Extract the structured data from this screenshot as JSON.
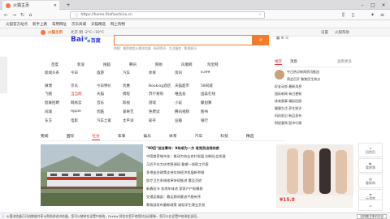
{
  "tab": {
    "title": "火狐主页"
  },
  "url": "https://home.firefoxchina.cn",
  "bookmarks": [
    "火狐官方站点",
    "新手上路",
    "常用网址",
    "京东商城",
    "天猫精选",
    "网上购物"
  ],
  "page_header": {
    "brand": "火狐主页",
    "weather": "北京 阴 -2°C~10°C",
    "right_links": [
      "设置",
      "火狐帮助"
    ]
  },
  "search": {
    "logo_prefix": "Bai",
    "logo_du": "百度",
    "button": "搜索"
  },
  "hot_words": "热搜：推荐使用火狐浏览器 · 新闻资讯 · 生活服务 · 影视娱乐",
  "grid": [
    [
      "百度",
      "新浪",
      "搜狐",
      "腾讯",
      "网易",
      "凤凰网",
      "淘宝网"
    ],
    [
      "新闻头条",
      "今日",
      "旅游",
      "汽车",
      "体育",
      "资讯",
      "4399"
    ],
    [
      "微博",
      "京东",
      "今日特价",
      "优惠",
      "Booking酒店",
      "天猫超市",
      "58同城"
    ],
    [
      "飞猪",
      "当当网",
      "天猫",
      "携程",
      "苏宁易购",
      "唯品会",
      "国美在线"
    ],
    [
      "智联招聘",
      "网易云",
      "音乐",
      "影视",
      "游戏",
      "小说",
      "聚划算"
    ],
    [
      "同城",
      "Apple",
      "优酷",
      "爱奇艺",
      "免费试",
      "腾讯视频",
      "图书"
    ],
    [
      "东方",
      "电影",
      "汽车之家",
      "太平洋",
      "知乎",
      "豆瓣",
      "银行"
    ]
  ],
  "right_panel": {
    "tabs": [
      "推荐",
      "消息",
      "查看更多"
    ],
    "lines": [
      "今日热点新闻资讯推送",
      "两会召开 聚焦民生热点",
      "好友动态 最新消息",
      "国际新闻 每日更新",
      "体育赛事 精彩回顾",
      "健康生活 养生知识",
      "科技前沿 新品发布",
      "财经要闻 股市行情"
    ]
  },
  "categories": [
    "要闻",
    "国际",
    "社会",
    "军事",
    "娱乐",
    "体育",
    "汽车",
    "科技",
    "精选"
  ],
  "active_category": "社会",
  "news": {
    "headline": "\"90后\"创业青年：9年成为一方 老党员出钱扶贫",
    "lines": [
      "中国首家城市化：推动为农业农村发展 创新社会发展",
      "习近平在大庆考察调研 看望一线职工代表",
      "多地出台政策支持实体经济发展新举措",
      "医疗卫生系统改革持续推进 惠及百姓",
      "新春佳节 各地年味浓 家家户户贴春联",
      "交通运输部：春运期间客流平稳有序",
      "教育部发布最新政策 减轻学生课业负担"
    ]
  },
  "ad": {
    "price": "¥15.8"
  },
  "side_icons": [
    {
      "name": "home-icon",
      "label": "回首页"
    },
    {
      "name": "video-icon",
      "label": "看视频"
    },
    {
      "name": "news-icon",
      "label": "看新闻"
    },
    {
      "name": "game-icon",
      "label": "玩游戏"
    },
    {
      "name": "ebook-icon",
      "label": "读小说"
    }
  ],
  "status": {
    "text": "火狐浏览器已开启数据共享以帮助改进浏览器，您可以随时在设置中修改。Firefox 将会在您不使用时自动更新，您可以在设置中修改此选项。",
    "button": "选择要共享的内容"
  }
}
